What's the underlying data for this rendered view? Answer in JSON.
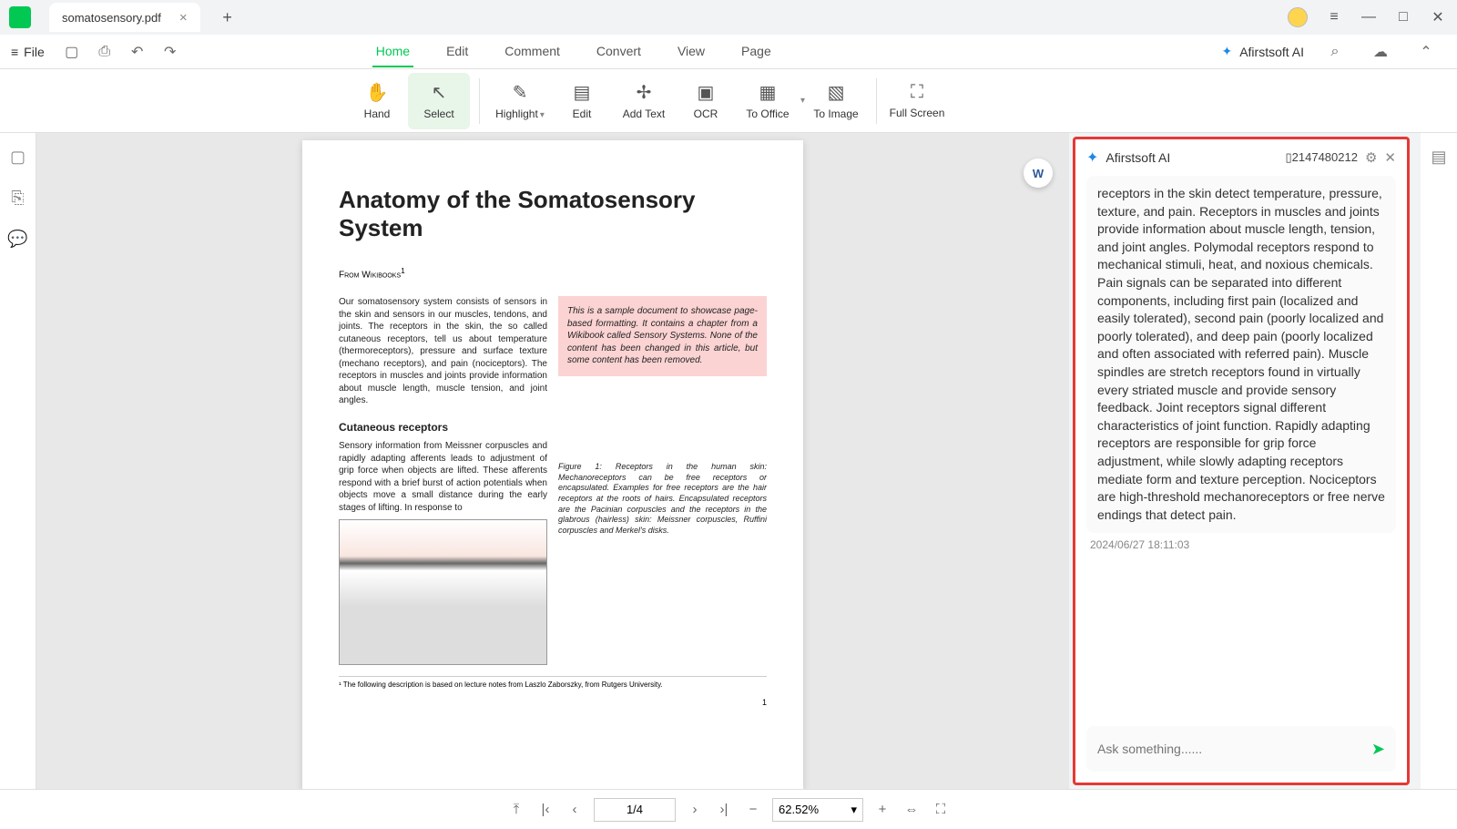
{
  "titlebar": {
    "filename": "somatosensory.pdf"
  },
  "file_menu": {
    "label": "File"
  },
  "menubar": {
    "items": [
      "Home",
      "Edit",
      "Comment",
      "Convert",
      "View",
      "Page"
    ],
    "active_index": 0
  },
  "ai_button": {
    "label": "Afirstsoft AI"
  },
  "toolbar": {
    "hand": "Hand",
    "select": "Select",
    "highlight": "Highlight",
    "edit": "Edit",
    "add_text": "Add Text",
    "ocr": "OCR",
    "to_office": "To Office",
    "to_image": "To Image",
    "full_screen": "Full Screen"
  },
  "document": {
    "title": "Anatomy of the Somatosensory System",
    "source": "From Wikibooks",
    "source_sup": "1",
    "intro": "Our somatosensory system consists of sensors in the skin and sensors in our muscles, tendons, and joints. The receptors in the skin, the so called cutaneous receptors, tell us about temperature (thermoreceptors), pressure and surface texture (mechano receptors), and pain (nociceptors). The receptors in muscles and joints provide information about muscle length, muscle tension, and joint angles.",
    "note": "This is a sample document to showcase page-based formatting. It contains a chapter from a Wikibook called Sensory Systems. None of the content has been changed in this article, but some content has been removed.",
    "subheading": "Cutaneous receptors",
    "para2": "Sensory information from Meissner corpuscles and rapidly adapting afferents leads to adjustment of grip force when objects are lifted. These afferents respond with a brief burst of action potentials when objects move a small distance during the early stages of lifting. In response to",
    "fig_caption": "Figure 1: Receptors in the human skin: Mechanoreceptors can be free receptors or encapsulated. Examples for free receptors are the hair receptors at the roots of hairs. Encapsulated receptors are the Pacinian corpuscles and the receptors in the glabrous (hairless) skin: Meissner corpuscles, Ruffini corpuscles and Merkel's disks.",
    "footnote": "¹ The following description is based on lecture notes from Laszlo Zaborszky, from Rutgers University.",
    "page_num": "1"
  },
  "ai_panel": {
    "title": "Afirstsoft AI",
    "token_count": "2147480212",
    "response": "receptors in the skin detect temperature, pressure, texture, and pain. Receptors in muscles and joints provide information about muscle length, tension, and joint angles. Polymodal receptors respond to mechanical stimuli, heat, and noxious chemicals. Pain signals can be separated into different components, including first pain (localized and easily tolerated), second pain (poorly localized and poorly tolerated), and deep pain (poorly localized and often associated with referred pain). Muscle spindles are stretch receptors found in virtually every striated muscle and provide sensory feedback. Joint receptors signal different characteristics of joint function. Rapidly adapting receptors are responsible for grip force adjustment, while slowly adapting receptors mediate form and texture perception. Nociceptors are high-threshold mechanoreceptors or free nerve endings that detect pain.",
    "timestamp": "2024/06/27 18:11:03",
    "input_placeholder": "Ask something......"
  },
  "bottombar": {
    "page": "1/4",
    "zoom": "62.52%"
  }
}
